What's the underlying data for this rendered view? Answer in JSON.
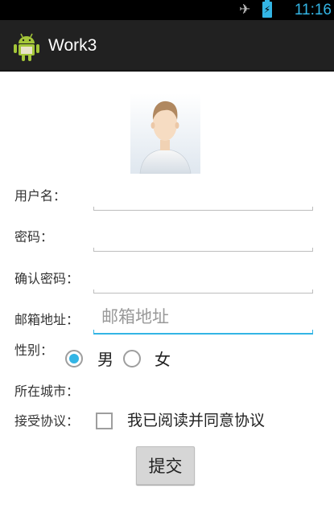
{
  "status_bar": {
    "time": "11:16",
    "icons": [
      "airplane-mode-icon",
      "battery-charging-icon"
    ],
    "accent": "#33b5e5"
  },
  "app": {
    "title": "Work3",
    "icon": "android-icon"
  },
  "form": {
    "avatar": "user-avatar",
    "username": {
      "label": "用户名：",
      "value": "",
      "placeholder": ""
    },
    "password": {
      "label": "密码：",
      "value": "",
      "placeholder": ""
    },
    "confirm_password": {
      "label": "确认密码：",
      "value": "",
      "placeholder": ""
    },
    "email": {
      "label": "邮箱地址：",
      "value": "",
      "placeholder": "邮箱地址"
    },
    "gender": {
      "label": "性别：",
      "options": [
        "男",
        "女"
      ],
      "selected": "男"
    },
    "city": {
      "label": "所在城市："
    },
    "agreement": {
      "label": "接受协议：",
      "checkbox_text": "我已阅读并同意协议",
      "checked": false
    },
    "submit_label": "提交"
  }
}
